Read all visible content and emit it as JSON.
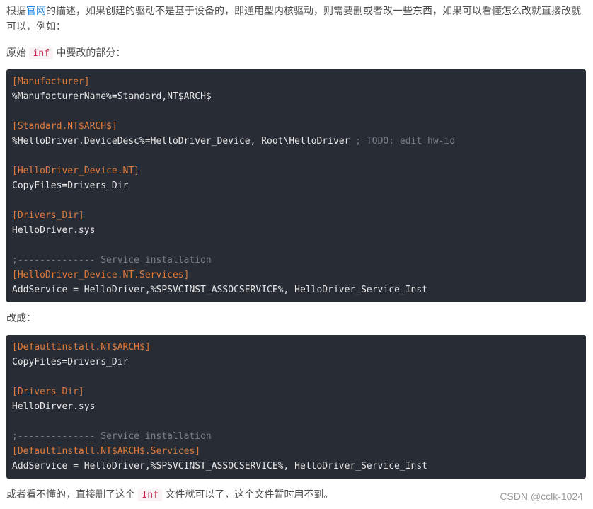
{
  "intro": {
    "text_before_link": "根据",
    "link_label": "官网",
    "text_after_link_line1": "的描述，如果创建的驱动不是基于设备的，即通用型内核驱动，则需要删或者改一些东西，如果可以看懂怎么改就直接改就",
    "text_line2": "可以，例如："
  },
  "original_label": {
    "before": "原始 ",
    "code": "inf",
    "after": " 中要改的部分："
  },
  "code_block_1": {
    "lines": [
      {
        "section": "[Manufacturer]"
      },
      {
        "text": "%ManufacturerName%=Standard,NT$ARCH$"
      },
      {
        "text": ""
      },
      {
        "section": "[Standard.NT$ARCH$]"
      },
      {
        "text": "%HelloDriver.DeviceDesc%=HelloDriver_Device, Root\\HelloDriver ",
        "comment": "; TODO: edit hw-id"
      },
      {
        "text": ""
      },
      {
        "section": "[HelloDriver_Device.NT]"
      },
      {
        "text": "CopyFiles=Drivers_Dir"
      },
      {
        "text": ""
      },
      {
        "section": "[Drivers_Dir]"
      },
      {
        "text": "HelloDriver.sys"
      },
      {
        "text": ""
      },
      {
        "comment": ";-------------- Service installation"
      },
      {
        "section": "[HelloDriver_Device.NT.Services]"
      },
      {
        "text": "AddService = HelloDriver,%SPSVCINST_ASSOCSERVICE%, HelloDriver_Service_Inst"
      }
    ]
  },
  "changed_label": "改成：",
  "code_block_2": {
    "lines": [
      {
        "section": "[DefaultInstall.NT$ARCH$]"
      },
      {
        "text": "CopyFiles=Drivers_Dir"
      },
      {
        "text": ""
      },
      {
        "section": "[Drivers_Dir]"
      },
      {
        "text": "HelloDirver.sys"
      },
      {
        "text": ""
      },
      {
        "comment": ";-------------- Service installation"
      },
      {
        "section": "[DefaultInstall.NT$ARCH$.Services]"
      },
      {
        "text": "AddService = HelloDriver,%SPSVCINST_ASSOCSERVICE%, HelloDriver_Service_Inst"
      }
    ]
  },
  "footer_note": {
    "before": "或者看不懂的，直接删了这个 ",
    "code": "Inf",
    "after": " 文件就可以了，这个文件暂时用不到。"
  },
  "watermark": "CSDN @cclk-1024"
}
